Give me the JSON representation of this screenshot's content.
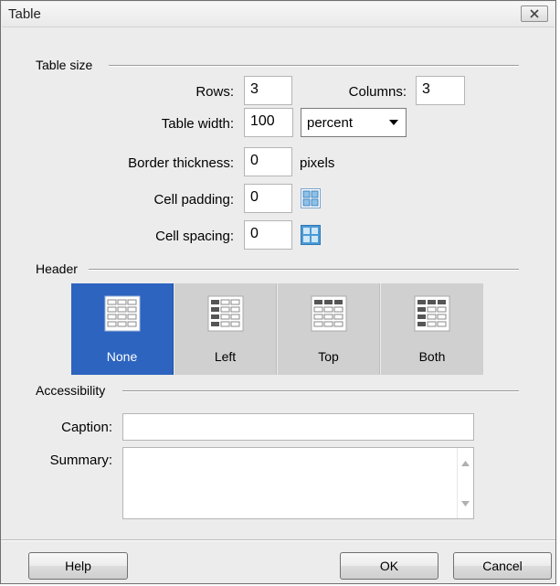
{
  "window": {
    "title": "Table"
  },
  "table_size": {
    "section_label": "Table size",
    "rows_label": "Rows:",
    "rows_value": "3",
    "columns_label": "Columns:",
    "columns_value": "3",
    "width_label": "Table width:",
    "width_value": "100",
    "width_unit": "percent",
    "border_label": "Border thickness:",
    "border_value": "0",
    "border_unit": "pixels",
    "padding_label": "Cell padding:",
    "padding_value": "0",
    "spacing_label": "Cell spacing:",
    "spacing_value": "0"
  },
  "header": {
    "section_label": "Header",
    "options": [
      {
        "label": "None",
        "selected": true
      },
      {
        "label": "Left",
        "selected": false
      },
      {
        "label": "Top",
        "selected": false
      },
      {
        "label": "Both",
        "selected": false
      }
    ]
  },
  "accessibility": {
    "section_label": "Accessibility",
    "caption_label": "Caption:",
    "caption_value": "",
    "summary_label": "Summary:",
    "summary_value": ""
  },
  "buttons": {
    "help": "Help",
    "ok": "OK",
    "cancel": "Cancel"
  },
  "colors": {
    "selected": "#2c64c0",
    "dialog_bg": "#ececec",
    "field_border": "#b5b5b5"
  }
}
